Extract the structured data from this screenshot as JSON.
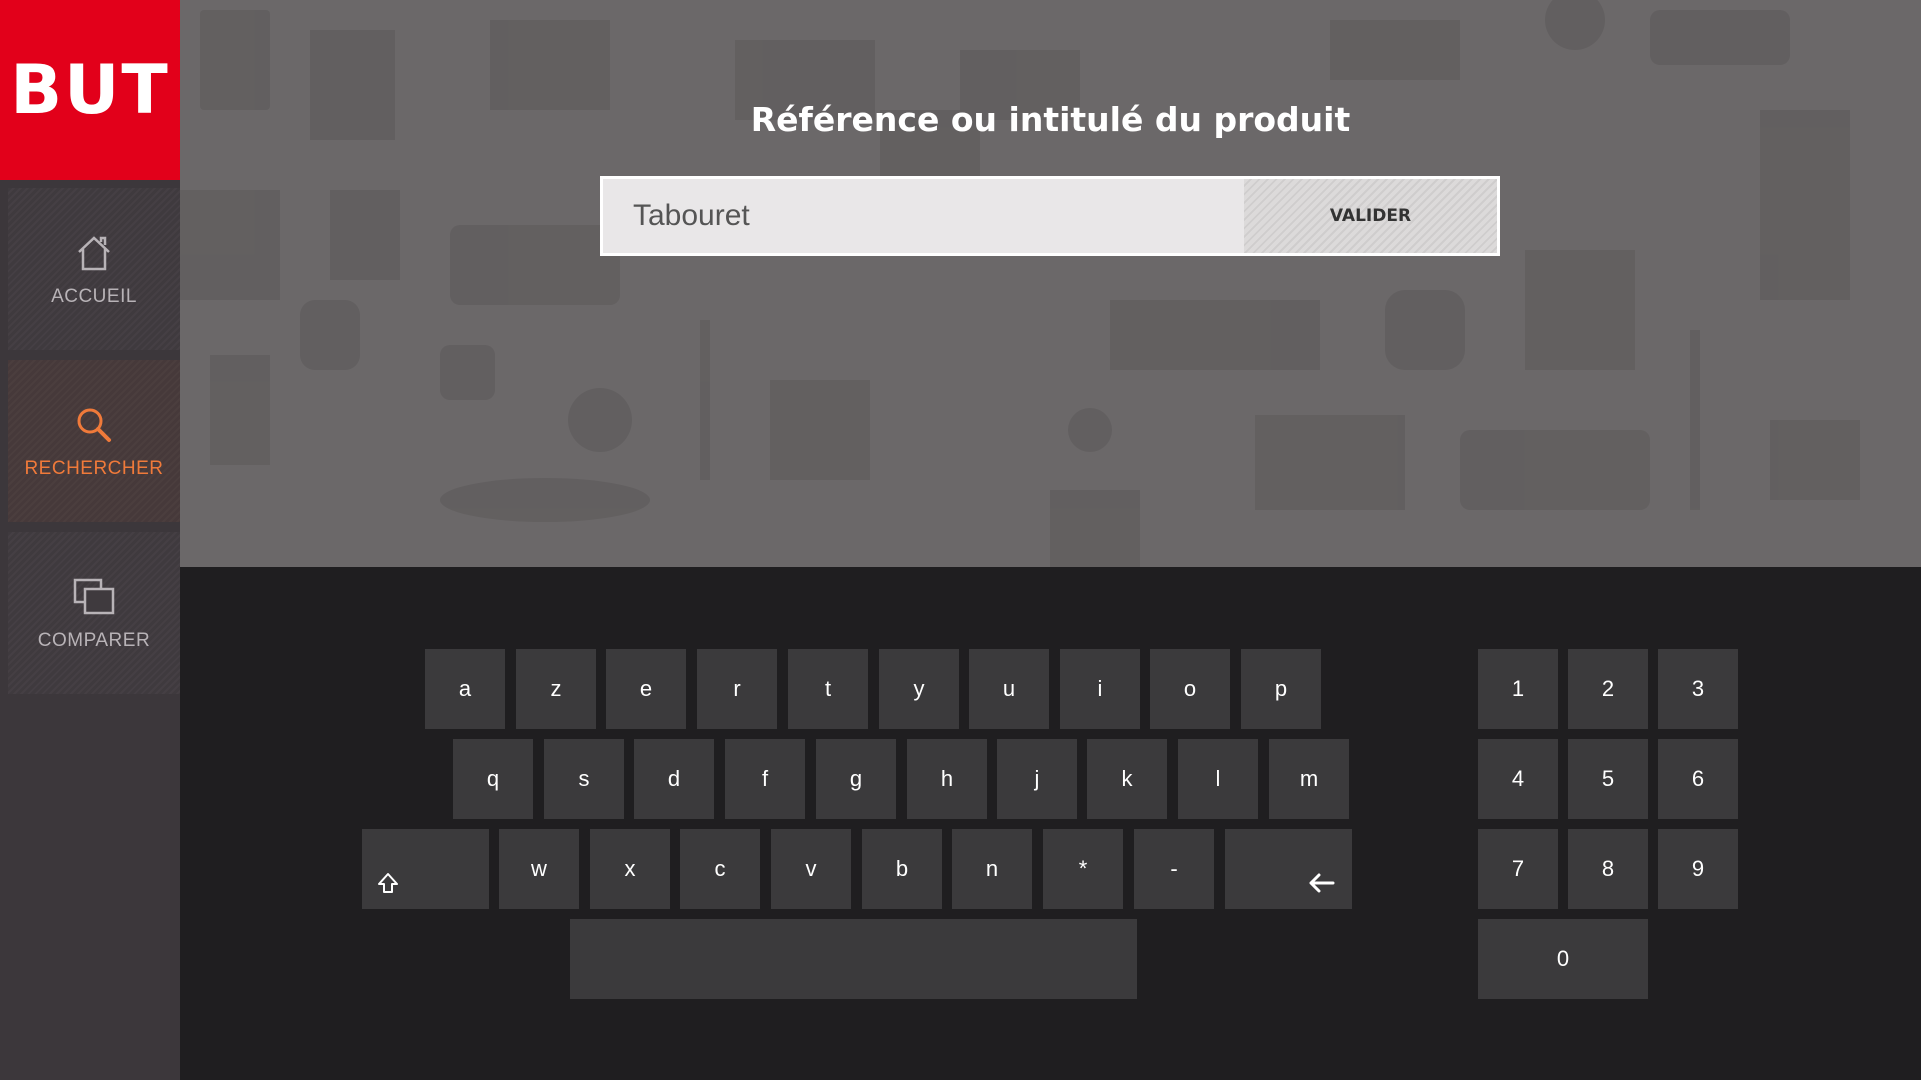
{
  "brand": {
    "logo_text": "BUT",
    "color": "#e2001a"
  },
  "sidebar": {
    "items": [
      {
        "label": "ACCUEIL",
        "icon": "home-icon",
        "active": false
      },
      {
        "label": "RECHERCHER",
        "icon": "search-icon",
        "active": true
      },
      {
        "label": "COMPARER",
        "icon": "compare-icon",
        "active": false
      }
    ],
    "active_color": "#f07a3a"
  },
  "search": {
    "title": "Référence ou intitulé du produit",
    "value": "Tabouret",
    "submit_label": "VALIDER"
  },
  "keyboard": {
    "row1": [
      "a",
      "z",
      "e",
      "r",
      "t",
      "y",
      "u",
      "i",
      "o",
      "p"
    ],
    "row2": [
      "q",
      "s",
      "d",
      "f",
      "g",
      "h",
      "j",
      "k",
      "l",
      "m"
    ],
    "row3": [
      "w",
      "x",
      "c",
      "v",
      "b",
      "n",
      "*",
      "-"
    ],
    "shift_icon": "shift-icon",
    "backspace_icon": "backspace-arrow-icon",
    "space": ""
  },
  "numpad": {
    "rows": [
      [
        "1",
        "2",
        "3"
      ],
      [
        "4",
        "5",
        "6"
      ],
      [
        "7",
        "8",
        "9"
      ]
    ],
    "zero": "0"
  }
}
